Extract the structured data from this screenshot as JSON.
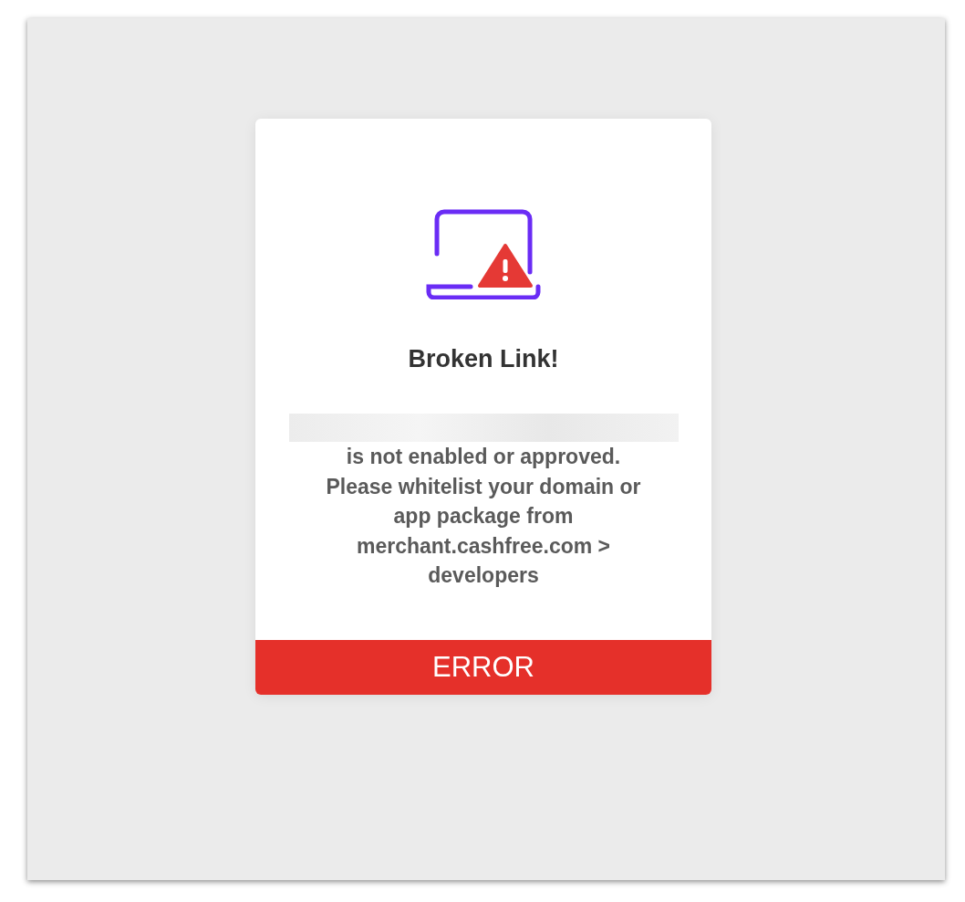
{
  "card": {
    "title": "Broken Link!",
    "message_redacted": true,
    "message_lines": [
      "is not enabled or approved.",
      "Please whitelist your domain or",
      "app package from",
      "merchant.cashfree.com >",
      "developers"
    ],
    "status": "ERROR"
  }
}
